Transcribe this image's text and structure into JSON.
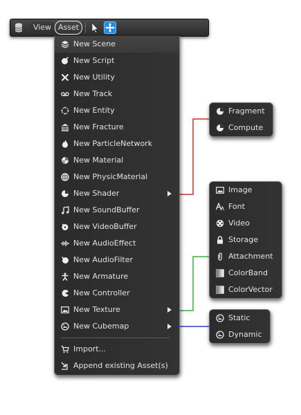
{
  "toolbar": {
    "view_label": "View",
    "asset_label": "Asset",
    "icons": [
      "database-icon",
      "cursor-icon",
      "move-icon"
    ]
  },
  "menu": {
    "items": [
      {
        "label": "New Scene",
        "icon": "layers-icon"
      },
      {
        "label": "New Script",
        "icon": "script-icon"
      },
      {
        "label": "New Utility",
        "icon": "tools-icon"
      },
      {
        "label": "New Track",
        "icon": "tape-icon"
      },
      {
        "label": "New Entity",
        "icon": "entity-icon"
      },
      {
        "label": "New Fracture",
        "icon": "building-icon"
      },
      {
        "label": "New ParticleNetwork",
        "icon": "flame-icon"
      },
      {
        "label": "New Material",
        "icon": "material-icon"
      },
      {
        "label": "New PhysicMaterial",
        "icon": "globe-icon"
      },
      {
        "label": "New Shader",
        "icon": "shader-icon"
      },
      {
        "label": "New SoundBuffer",
        "icon": "music-note-icon"
      },
      {
        "label": "New VideoBuffer",
        "icon": "video-buffer-icon"
      },
      {
        "label": "New AudioEffect",
        "icon": "waveform-icon"
      },
      {
        "label": "New AudioFilter",
        "icon": "audio-filter-icon"
      },
      {
        "label": "New Armature",
        "icon": "figure-icon"
      },
      {
        "label": "New Controller",
        "icon": "pacman-icon"
      },
      {
        "label": "New Texture",
        "icon": "image-icon"
      },
      {
        "label": "New Cubemap",
        "icon": "cubemap-icon"
      }
    ],
    "import_label": "Import...",
    "append_label": "Append existing Asset(s)"
  },
  "shader_submenu": {
    "items": [
      {
        "label": "Fragment",
        "icon": "shader-icon"
      },
      {
        "label": "Compute",
        "icon": "shader-icon"
      }
    ]
  },
  "texture_submenu": {
    "items": [
      {
        "label": "Image",
        "icon": "image-icon"
      },
      {
        "label": "Font",
        "icon": "font-icon"
      },
      {
        "label": "Video",
        "icon": "film-reel-icon"
      },
      {
        "label": "Storage",
        "icon": "lock-icon"
      },
      {
        "label": "Attachment",
        "icon": "paperclip-icon"
      },
      {
        "label": "ColorBand",
        "icon": "gradient-icon"
      },
      {
        "label": "ColorVector",
        "icon": "gradient-icon"
      }
    ]
  },
  "cubemap_submenu": {
    "items": [
      {
        "label": "Static",
        "icon": "cubemap-icon"
      },
      {
        "label": "Dynamic",
        "icon": "cubemap-icon"
      }
    ]
  },
  "colors": {
    "accent": "#1f8be8",
    "shader_connector": "#c0392b",
    "texture_connector": "#3cb043",
    "cubemap_connector": "#2f3fc8"
  }
}
